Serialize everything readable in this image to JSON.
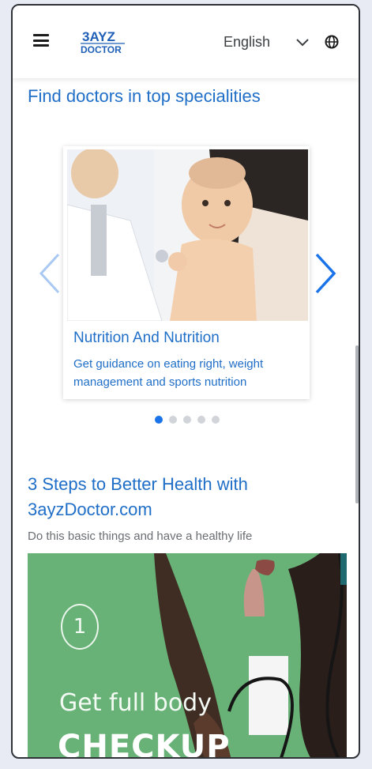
{
  "header": {
    "logo_line1": "3AYZ",
    "logo_line2": "DOCTOR",
    "language_selected": "English"
  },
  "specialities": {
    "title": "Find doctors in top specialities",
    "card": {
      "title": "Nutrition And Nutrition",
      "description": "Get guidance on eating right, weight management and sports nutrition"
    },
    "carousel_total_slides": 5,
    "carousel_active_index": 0
  },
  "health_steps": {
    "title": "3 Steps to Better Health with 3ayzDoctor.com",
    "subtitle": "Do this basic things and have a healthy life",
    "promo": {
      "step_number": "1",
      "line1": "Get full body",
      "line2": "CHECKUP"
    }
  },
  "colors": {
    "accent_blue": "#1f6ec7",
    "promo_green": "#69b277",
    "dot_active": "#1a73e8",
    "dot_inactive": "#d1d4d8"
  },
  "icons": [
    "menu-icon",
    "chevron-down-icon",
    "globe-icon",
    "chevron-left-icon",
    "chevron-right-icon"
  ]
}
